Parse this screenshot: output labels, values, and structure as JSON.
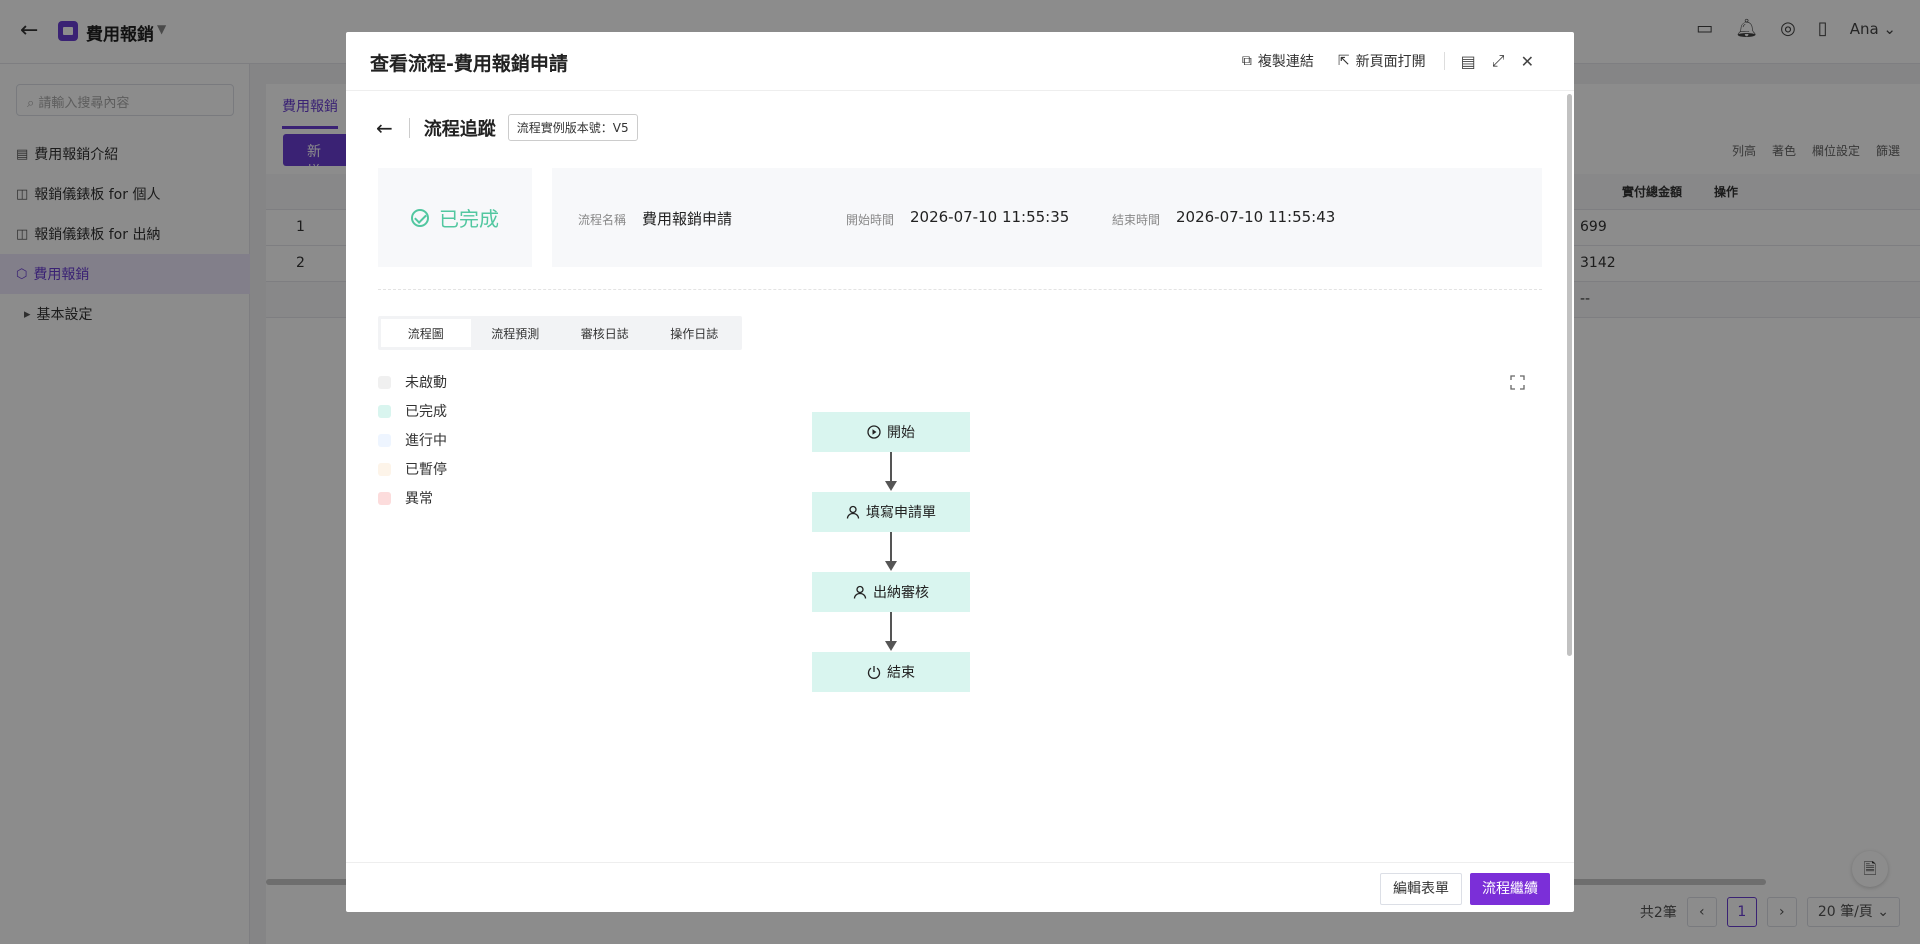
{
  "app": {
    "title": "費用報銷",
    "user": "Ana"
  },
  "sidebar": {
    "search_placeholder": "請輸入搜尋內容",
    "items": [
      {
        "label": "費用報銷介紹"
      },
      {
        "label": "報銷儀錶板 for 個人"
      },
      {
        "label": "報銷儀錶板 for 出納"
      },
      {
        "label": "費用報銷"
      },
      {
        "label": "基本設定"
      }
    ]
  },
  "background": {
    "tab": "費用報銷",
    "add_button": "新 增",
    "tools": [
      "列高",
      "著色",
      "欄位設定",
      "篩選"
    ],
    "columns": [
      "實付總金額",
      "操作"
    ],
    "rows": [
      {
        "index": "1",
        "amount": "699"
      },
      {
        "index": "2",
        "amount": "3142"
      }
    ],
    "empty_cell": "--",
    "total": "共2筆",
    "page": "1",
    "page_size": "20 筆/頁"
  },
  "modal": {
    "title": "查看流程-費用報銷申請",
    "actions": {
      "copy_link": "複製連結",
      "open_new_page": "新頁面打開"
    },
    "track_title": "流程追蹤",
    "version": "流程實例版本號：V5",
    "status": "已完成",
    "info": {
      "name_label": "流程名稱",
      "name_value": "費用報銷申請",
      "start_label": "開始時間",
      "start_value": "2026-07-10 11:55:35",
      "end_label": "結束時間",
      "end_value": "2026-07-10 11:55:43"
    },
    "tabs": [
      "流程圖",
      "流程預測",
      "審核日誌",
      "操作日誌"
    ],
    "legend": [
      {
        "label": "未啟動",
        "color": "#f0f0f0"
      },
      {
        "label": "已完成",
        "color": "#d9f5ef"
      },
      {
        "label": "進行中",
        "color": "#eef5ff"
      },
      {
        "label": "已暫停",
        "color": "#fdf4e9"
      },
      {
        "label": "異常",
        "color": "#fcdcdc"
      }
    ],
    "nodes": [
      {
        "label": "開始",
        "icon": "play-circle-icon"
      },
      {
        "label": "填寫申請單",
        "icon": "user-icon"
      },
      {
        "label": "出納審核",
        "icon": "user-icon"
      },
      {
        "label": "結束",
        "icon": "power-icon"
      }
    ],
    "footer": {
      "edit_label": "編輯表單",
      "continue_label": "流程繼續"
    }
  },
  "colors": {
    "brand": "#6a3fd3",
    "completed": "#52c7a0",
    "node_fill": "#d9f5ef"
  }
}
